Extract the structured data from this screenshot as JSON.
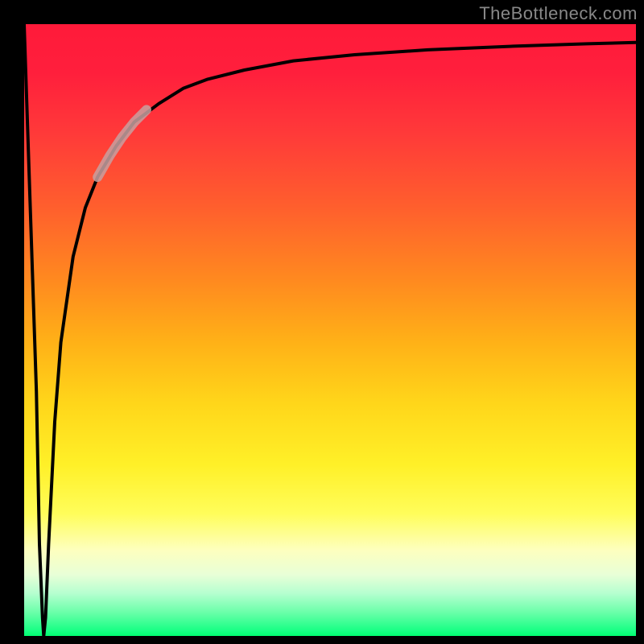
{
  "watermark": {
    "text": "TheBottleneck.com"
  },
  "colors": {
    "page_bg": "#000000",
    "curve": "#000000",
    "highlight": "#c8a0a0"
  },
  "chart_data": {
    "type": "line",
    "title": "",
    "xlabel": "",
    "ylabel": "",
    "xlim": [
      0,
      100
    ],
    "ylim": [
      0,
      100
    ],
    "grid": false,
    "legend": false,
    "annotations": [
      "TheBottleneck.com"
    ],
    "series": [
      {
        "name": "main-curve",
        "x": [
          0,
          1,
          2,
          2.5,
          3,
          3.2,
          3.5,
          4,
          5,
          6,
          8,
          10,
          12,
          15,
          18,
          22,
          26,
          30,
          36,
          44,
          54,
          66,
          80,
          92,
          100
        ],
        "y": [
          100,
          70,
          40,
          15,
          3,
          0,
          3,
          15,
          35,
          48,
          62,
          70,
          75,
          80,
          84,
          87,
          89.5,
          91,
          92.5,
          94,
          95,
          95.8,
          96.4,
          96.8,
          97
        ]
      },
      {
        "name": "highlight-segment",
        "x": [
          12,
          14,
          16,
          18,
          20
        ],
        "y": [
          75,
          78.5,
          81.5,
          84,
          86
        ]
      }
    ]
  }
}
